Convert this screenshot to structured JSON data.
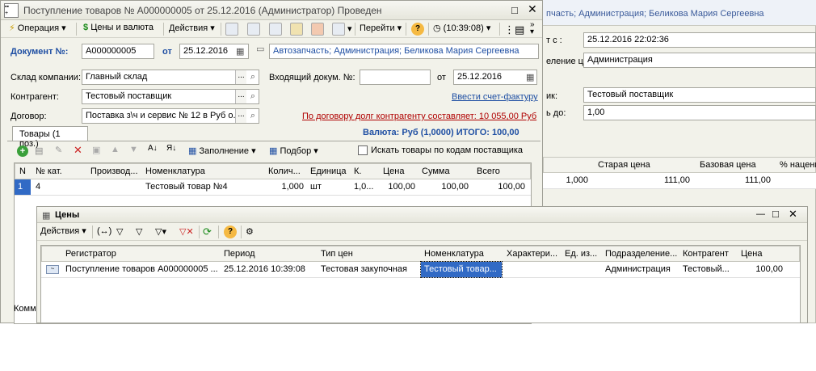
{
  "background": {
    "header_text": "пчасть; Администрация; Беликова Мария Сергеевна",
    "date_label": "т с :",
    "date_value": "25.12.2016 22:02:36",
    "dept_label": "еление ц...",
    "dept_value": "Администрация",
    "supplier_label": "ик:",
    "supplier_value": "Тестовый поставщик",
    "rate_label": "ь до:",
    "rate_value": "1,00",
    "columns": [
      "Старая цена",
      "Базовая цена",
      "% наценк"
    ],
    "row": {
      "qty": "1,000",
      "old_price": "111,00",
      "base_price": "111,00"
    }
  },
  "doc": {
    "title": "Поступление товаров № A000000005 от 25.12.2016 (Администратор) Проведен",
    "toolbar": {
      "operation": "Операция",
      "prices": "Цены и валюта",
      "actions": "Действия",
      "goto": "Перейти",
      "time": "(10:39:08)"
    },
    "doc_number_label": "Документ №:",
    "doc_number": "A000000005",
    "from_label": "от",
    "doc_date": "25.12.2016",
    "org": "Автозапчасть; Администрация; Беликова Мария Сергеевна",
    "warehouse_label": "Склад компании:",
    "warehouse": "Главный склад",
    "incoming_label": "Входящий докум. №:",
    "incoming": "",
    "from2_label": "от",
    "incoming_date": "25.12.2016",
    "counterparty_label": "Контрагент:",
    "counterparty": "Тестовый поставщик",
    "invoice_link": "Ввести счет-фактуру",
    "contract_label": "Договор:",
    "contract": "Поставка з\\ч и сервис № 12 в Руб о...",
    "debt_text": "По договору долг контрагенту составляет: 10 055,00 Руб",
    "tab_label": "Товары (1 поз.)",
    "currency_total": "Валюта: Руб (1,0000) ИТОГО: 100,00",
    "fill_btn": "Заполнение",
    "select_btn": "Подбор",
    "search_by_code": "Искать товары по кодам поставщика",
    "columns": [
      "N",
      "№ кат.",
      "Производ...",
      "Номенклатура",
      "Колич...",
      "Единица",
      "К.",
      "Цена",
      "Сумма",
      "Всего"
    ],
    "row": [
      "1",
      "4",
      "",
      "Тестовый товар №4",
      "1,000",
      "шт",
      "1,0...",
      "100,00",
      "100,00",
      "100,00"
    ],
    "comment_stub": "Комм"
  },
  "prices": {
    "title": "Цены",
    "actions": "Действия",
    "columns": [
      "Регистратор",
      "Период",
      "Тип цен",
      "Номенклатура",
      "Характери...",
      "Ед. из...",
      "Подразделение...",
      "Контрагент",
      "Цена"
    ],
    "row": [
      "Поступление товаров A000000005 ...",
      "25.12.2016 10:39:08",
      "Тестовая закупочная",
      "Тестовый товар...",
      "",
      "",
      "Администрация",
      "Тестовый...",
      "100,00"
    ]
  }
}
